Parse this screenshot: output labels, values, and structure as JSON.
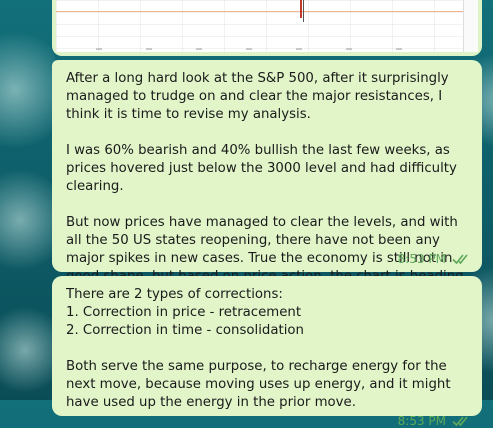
{
  "messages": [
    {
      "paragraphs": [
        "After a long hard look at the S&P 500, after it surprisingly managed to trudge on and clear the major resistances, I think it is time to revise my analysis.",
        "I was 60% bearish and 40% bullish the last few weeks, as prices hovered just below the 3000 level and had difficulty clearing.",
        "But now prices have managed to clear the levels, and with all the 50 US states reopening, there have not been any major spikes in new cases. True the economy is still not in good shape, but based on price action, the chart is heading upwards."
      ],
      "time": "8:53 PM",
      "status_icon": "double-check-icon"
    },
    {
      "paragraphs": [
        "There are 2 types of corrections:\n1. Correction in price - retracement\n2. Correction in time - consolidation",
        "Both serve the same purpose, to recharge energy for the next move, because moving uses up energy, and it might have used up the energy in the prior move."
      ],
      "time": "8:53 PM",
      "status_icon": "double-check-icon"
    }
  ],
  "colors": {
    "bubble": "#e1f5c9",
    "time_text": "#5fa85a",
    "wallpaper": "#0e5f6a"
  }
}
